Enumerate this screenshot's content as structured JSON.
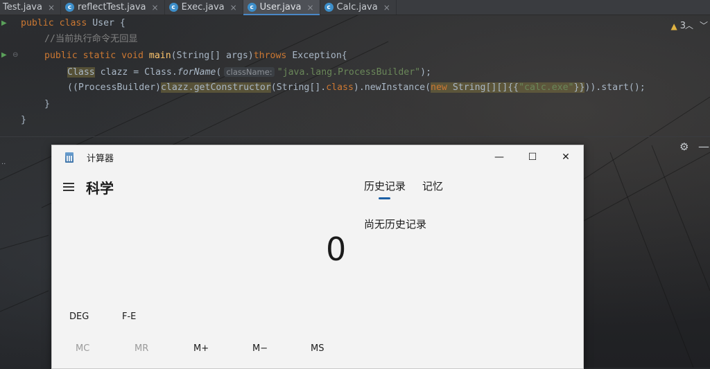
{
  "ide": {
    "tabs": [
      {
        "label": "Test.java",
        "icon": null,
        "active": false
      },
      {
        "label": "reflectTest.java",
        "icon": "class-icon",
        "active": false
      },
      {
        "label": "Exec.java",
        "icon": "class-icon",
        "active": false
      },
      {
        "label": "User.java",
        "icon": "class-icon",
        "active": true
      },
      {
        "label": "Calc.java",
        "icon": "class-icon",
        "active": false
      }
    ],
    "tab_close_glyph": "×",
    "warnings": {
      "count": "3"
    },
    "code": {
      "line1_kw": "public class",
      "line1_rest": " User {",
      "line2_comment": "//当前执行命令无回显",
      "line3_kw1": "public static void",
      "line3_fn": "main",
      "line3_mid": "(String[] args)",
      "line3_kw2": "throws",
      "line3_end": " Exception{",
      "line4_type": "Class",
      "line4_mid": " clazz = Class.",
      "line4_call": "forName",
      "line4_paren": "(",
      "line4_hint": "className:",
      "line4_str": "\"java.lang.ProcessBuilder\"",
      "line4_end": ");",
      "line5_a": "((ProcessBuilder)",
      "line5_b": "clazz.getConstructor",
      "line5_c": "(String[].",
      "line5_kw": "class",
      "line5_d": ").newInstance(",
      "line5_new": "new",
      "line5_e": " String[][]{{",
      "line5_str": "\"calc.exe\"",
      "line5_f": "}}",
      "line5_g": ")).start();",
      "line6": "}",
      "line7": "}"
    }
  },
  "calculator": {
    "window_title": "计算器",
    "mode": "科学",
    "tabs": {
      "history": "历史记录",
      "memory": "记忆"
    },
    "history_empty": "尚无历史记录",
    "display": "0",
    "angle_unit": "DEG",
    "fe_label": "F-E",
    "memory_buttons": [
      "MC",
      "MR",
      "M+",
      "M−",
      "MS"
    ]
  }
}
